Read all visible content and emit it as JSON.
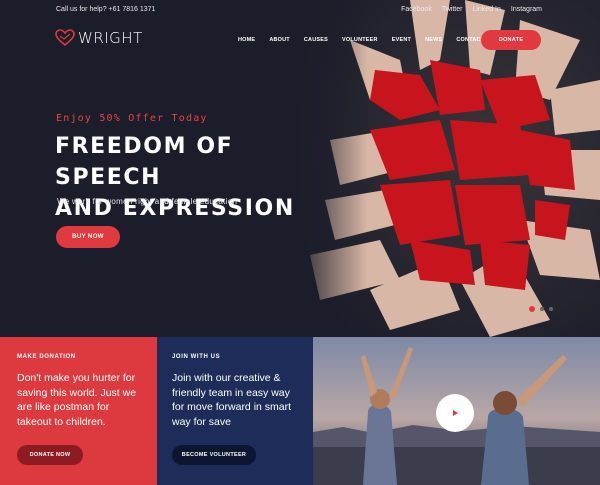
{
  "topbar": {
    "help": "Call us for help? +61 7816 1371",
    "social": [
      "Facebook",
      "Twitter",
      "Linked In",
      "Instagram"
    ]
  },
  "brand": {
    "name": "WRIGHT",
    "accent": "#e0393f"
  },
  "nav": {
    "items": [
      "HOME",
      "ABOUT",
      "CAUSES",
      "VOLUNTEER",
      "EVENT",
      "NEWS",
      "CONTACT"
    ],
    "donate": "DONATE"
  },
  "hero": {
    "offer": "Enjoy 50% Offer Today",
    "headline_line1": "FREEDOM OF SPEECH",
    "headline_line2": "AND EXPRESSION",
    "subtext": "We work for women right and female education",
    "cta": "BUY NOW"
  },
  "panels": {
    "donation": {
      "eyebrow": "MAKE DONATION",
      "copy": "Don't make you hurter for saving this world. Just we are like postman for takeout to children.",
      "button": "DONATE NOW",
      "color": "#dd3a40"
    },
    "volunteer": {
      "eyebrow": "JOIN WITH US",
      "copy": "Join with our creative & friendly team in easy way for move forward in smart way for save",
      "button": "BECOME VOLUNTEER",
      "color": "#1e2c59"
    },
    "video": {
      "icon": "play-icon"
    }
  }
}
